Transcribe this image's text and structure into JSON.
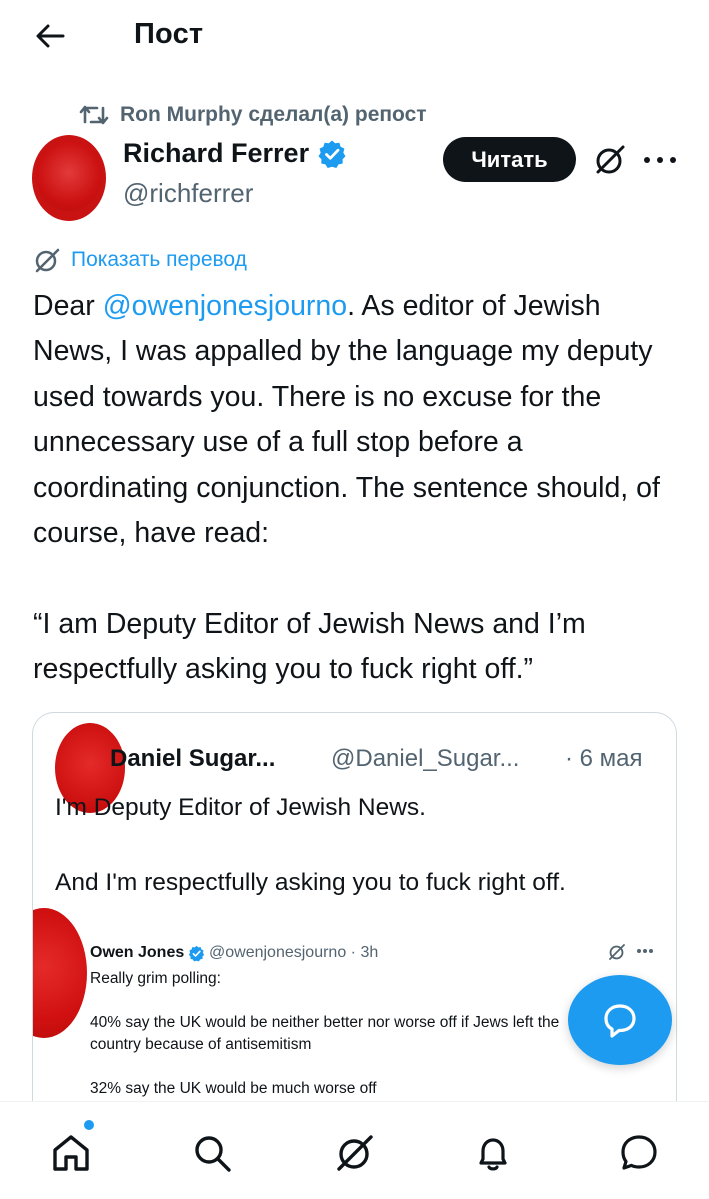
{
  "header": {
    "back_icon": "arrow-left-icon",
    "title": "Пост"
  },
  "post": {
    "repost_label": "Ron Murphy сделал(а) репост",
    "author_name": "Richard Ferrer",
    "author_handle": "@richferrer",
    "follow_label": "Читать",
    "translate_label": "Показать перевод",
    "text_before_mention": "Dear ",
    "mention": "@owenjonesjourno",
    "text_after_mention": ". As editor of Jewish News, I was appalled by the language my deputy used towards you. There is no excuse for the unnecessary use of a full stop before a coordinating conjunction. The sentence should, of course, have read:\n\n“I am Deputy Editor of Jewish News and I’m respectfully asking you to fuck right off.”"
  },
  "quote": {
    "name": "Daniel Sugar...",
    "handle": "@Daniel_Sugar...",
    "date": "· 6 мая",
    "text": "I'm Deputy Editor of Jewish News.\n\nAnd I'm respectfully asking you to fuck right off.",
    "embedded": {
      "name": "Owen Jones",
      "handle": "@owenjonesjourno · 3h",
      "text": "Really grim polling:\n\n40% say the UK would be neither better nor worse off if Jews left the country because of antisemitism\n\n32% say the UK would be much worse off"
    }
  },
  "colors": {
    "accent": "#1d9bf0",
    "text": "#0f1419",
    "secondary": "#536471",
    "redaction": "#d01010"
  },
  "nav": {
    "items": [
      "home-icon",
      "search-icon",
      "grok-icon",
      "notifications-icon",
      "messages-icon"
    ],
    "fab_icon": "new-message-icon"
  }
}
